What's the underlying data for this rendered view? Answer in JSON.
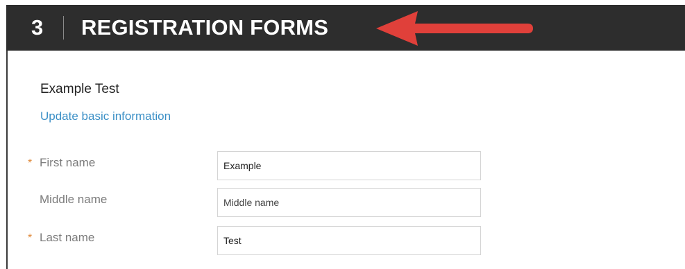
{
  "header": {
    "section_number": "3",
    "section_title": "REGISTRATION FORMS"
  },
  "annotation": {
    "arrow_icon": "left-arrow-icon",
    "arrow_color": "#e0403a"
  },
  "profile": {
    "name": "Example Test",
    "update_link": "Update basic information"
  },
  "form": {
    "fields": [
      {
        "label": "First name",
        "required": true,
        "value": "Example",
        "placeholder": ""
      },
      {
        "label": "Middle name",
        "required": false,
        "value": "",
        "placeholder": "Middle name"
      },
      {
        "label": "Last name",
        "required": true,
        "value": "Test",
        "placeholder": ""
      }
    ],
    "required_marker": "*"
  },
  "colors": {
    "header_bg": "#2d2d2d",
    "link": "#3a8fc6",
    "required_star": "#e08a3c"
  }
}
